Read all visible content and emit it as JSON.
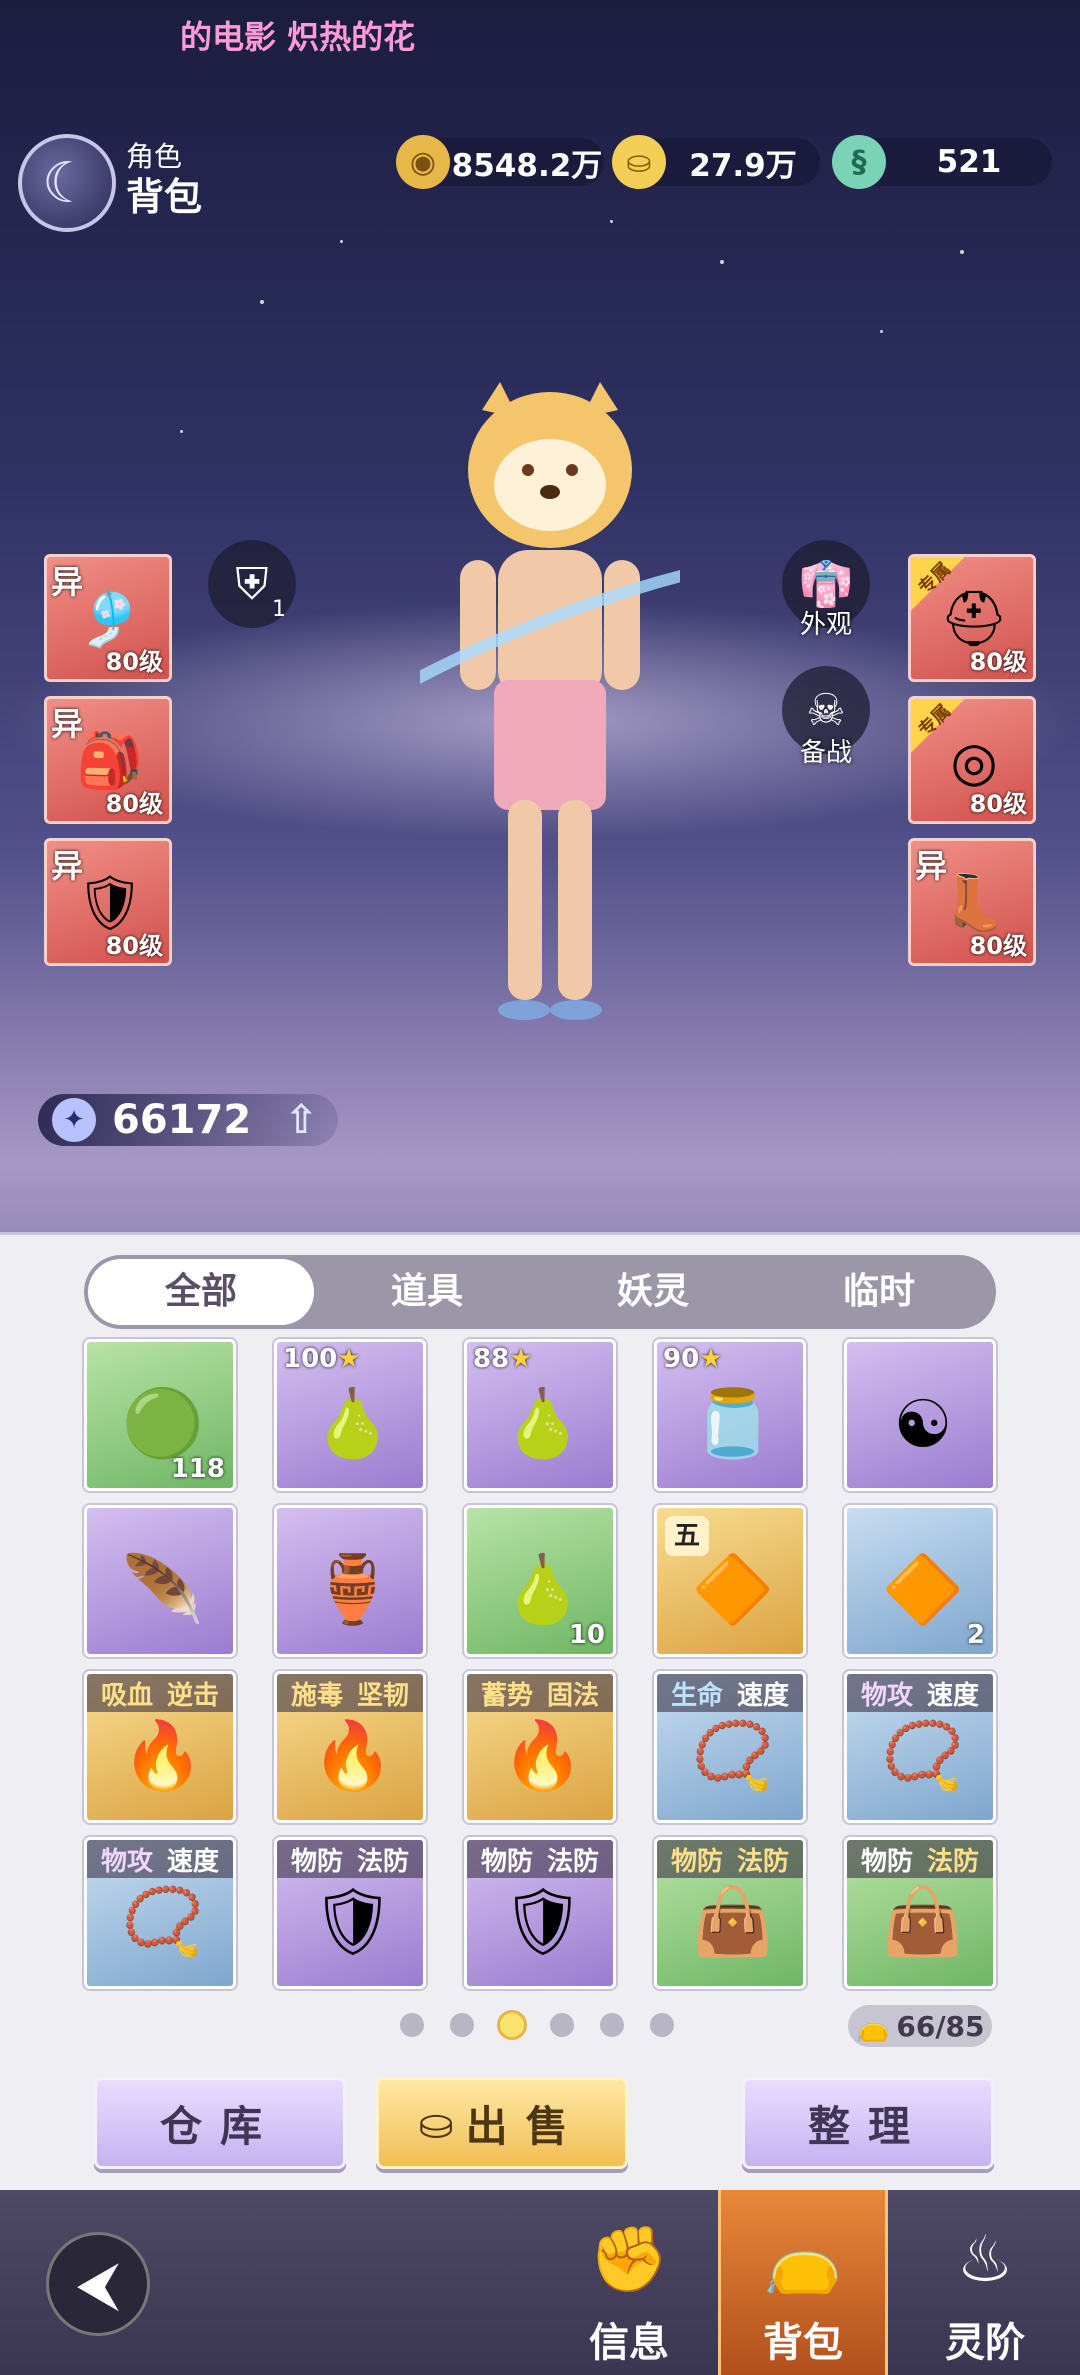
{
  "ticker": {
    "text": "的电影 炽热的花"
  },
  "header": {
    "sub": "角色",
    "title": "背包"
  },
  "currencies": [
    {
      "icon": "copper-coin-icon",
      "value": "8548.2万"
    },
    {
      "icon": "gold-ingot-icon",
      "value": "27.9万"
    },
    {
      "icon": "jade-dragon-icon",
      "value": "521"
    }
  ],
  "equip_left": [
    {
      "tag": "异",
      "level": "80级",
      "icon": "flute-icon"
    },
    {
      "tag": "异",
      "level": "80级",
      "icon": "pouch-icon"
    },
    {
      "tag": "异",
      "level": "80级",
      "icon": "armor-icon"
    }
  ],
  "equip_right": [
    {
      "tag": "专属",
      "level": "80级",
      "icon": "helmet-icon"
    },
    {
      "tag": "专属",
      "level": "80级",
      "icon": "belt-icon"
    },
    {
      "tag": "异",
      "level": "80级",
      "icon": "boots-icon"
    }
  ],
  "armor_badge": {
    "count": "1"
  },
  "side_buttons": {
    "appearance": "外观",
    "prepare": "备战"
  },
  "power": {
    "value": "66172"
  },
  "tabs": [
    {
      "label": "全部",
      "active": true
    },
    {
      "label": "道具",
      "active": false
    },
    {
      "label": "妖灵",
      "active": false
    },
    {
      "label": "临时",
      "active": false
    }
  ],
  "items": [
    {
      "color": "green",
      "icon": "green-orb-icon",
      "count": "118"
    },
    {
      "color": "purple",
      "icon": "gourd-icon",
      "star": "100"
    },
    {
      "color": "purple",
      "icon": "gourd-icon",
      "star": "88"
    },
    {
      "color": "purple",
      "icon": "jar-icon",
      "star": "90"
    },
    {
      "color": "purple",
      "icon": "yin-yang-charm-icon"
    },
    {
      "color": "purple",
      "icon": "golden-feather-icon"
    },
    {
      "color": "purple",
      "icon": "blue-gourd-icon"
    },
    {
      "color": "green",
      "icon": "gourd-icon",
      "count": "10"
    },
    {
      "color": "gold",
      "icon": "amber-gem-icon",
      "tier": "五"
    },
    {
      "color": "blue",
      "icon": "amber-gem-icon",
      "count": "2"
    },
    {
      "color": "gold",
      "icon": "red-pouch-icon",
      "attr1": "吸血",
      "attr2": "逆击"
    },
    {
      "color": "gold",
      "icon": "red-pouch-icon",
      "attr1": "施毒",
      "attr2": "坚韧"
    },
    {
      "color": "gold",
      "icon": "red-pouch-icon",
      "attr1": "蓄势",
      "attr2": "固法"
    },
    {
      "color": "blue",
      "icon": "necklace-icon",
      "attr1": "生命",
      "attr2": "速度"
    },
    {
      "color": "blue",
      "icon": "necklace-icon",
      "attr1": "物攻",
      "attr2": "速度"
    },
    {
      "color": "blue",
      "icon": "necklace-icon",
      "attr1": "物攻",
      "attr2": "速度"
    },
    {
      "color": "purple",
      "icon": "shoulder-armor-icon",
      "attr1": "物防",
      "attr2": "法防"
    },
    {
      "color": "purple",
      "icon": "shoulder-armor-icon",
      "attr1": "物防",
      "attr2": "法防"
    },
    {
      "color": "green",
      "icon": "leather-bag-icon",
      "attr1": "物防",
      "attr2": "法防"
    },
    {
      "color": "green",
      "icon": "leather-bag-icon",
      "attr1": "物防",
      "attr2": "法防"
    }
  ],
  "pagination": {
    "pages": 6,
    "current": 3
  },
  "capacity": {
    "text": "66/85"
  },
  "buttons": {
    "warehouse": "仓库",
    "sell": "出售",
    "sort": "整理"
  },
  "nav": {
    "info": "信息",
    "bag": "背包",
    "spirit": "灵阶"
  }
}
